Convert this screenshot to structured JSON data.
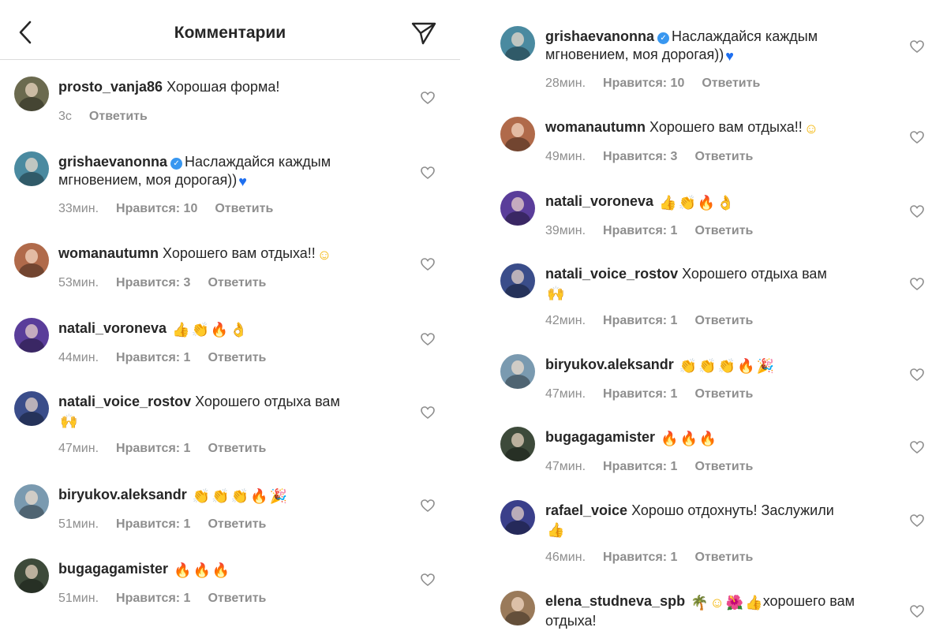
{
  "header": {
    "title": "Комментарии"
  },
  "left": [
    {
      "user": "prosto_vanja86",
      "verified": false,
      "text": "Хорошая форма!",
      "emojis": [],
      "text2": "",
      "time": "3с",
      "likes": "",
      "reply": "Ответить",
      "avatar_bg": "#6b6a4f"
    },
    {
      "user": "grishaevanonna",
      "verified": true,
      "text": "Наслаждайся каждым мгновением, моя дорогая))",
      "emojis": [
        {
          "g": "♥",
          "c": "emo-heart"
        }
      ],
      "text2": "",
      "time": "33мин.",
      "likes": "Нравится: 10",
      "reply": "Ответить",
      "avatar_bg": "#4a8aa0"
    },
    {
      "user": "womanautumn",
      "verified": false,
      "text": "Хорошего вам отдыха!!",
      "emojis": [
        {
          "g": "☺",
          "c": "emo-smile"
        }
      ],
      "text2": "",
      "time": "53мин.",
      "likes": "Нравится: 3",
      "reply": "Ответить",
      "avatar_bg": "#b06a4a"
    },
    {
      "user": "natali_voroneva",
      "verified": false,
      "text": "",
      "emojis": [
        {
          "g": "👍",
          "c": "emo-thumb"
        },
        {
          "g": "👏",
          "c": "emo-clap"
        },
        {
          "g": "🔥",
          "c": "emo-fire"
        },
        {
          "g": "👌",
          "c": "emo-ok"
        }
      ],
      "text2": "",
      "time": "44мин.",
      "likes": "Нравится: 1",
      "reply": "Ответить",
      "avatar_bg": "#5a3d9a"
    },
    {
      "user": "natali_voice_rostov",
      "verified": false,
      "text": "Хорошего отдыха вам",
      "emojis": [],
      "text2": "🙌",
      "time": "47мин.",
      "likes": "Нравится: 1",
      "reply": "Ответить",
      "avatar_bg": "#3a4d8a"
    },
    {
      "user": "biryukov.aleksandr",
      "verified": false,
      "text": "",
      "emojis": [
        {
          "g": "👏",
          "c": "emo-clap"
        },
        {
          "g": "👏",
          "c": "emo-clap"
        },
        {
          "g": "👏",
          "c": "emo-clap"
        },
        {
          "g": "🔥",
          "c": "emo-fire"
        },
        {
          "g": "🎉",
          "c": "emo-party"
        }
      ],
      "text2": "",
      "time": "51мин.",
      "likes": "Нравится: 1",
      "reply": "Ответить",
      "avatar_bg": "#7a9ab0"
    },
    {
      "user": "bugagagamister",
      "verified": false,
      "text": "",
      "emojis": [
        {
          "g": "🔥",
          "c": "emo-fire"
        },
        {
          "g": "🔥",
          "c": "emo-fire"
        },
        {
          "g": "🔥",
          "c": "emo-fire"
        }
      ],
      "text2": "",
      "time": "51мин.",
      "likes": "Нравится: 1",
      "reply": "Ответить",
      "avatar_bg": "#3d4a3a"
    }
  ],
  "right": [
    {
      "user": "grishaevanonna",
      "verified": true,
      "text": "Наслаждайся каждым мгновением, моя дорогая))",
      "emojis": [
        {
          "g": "♥",
          "c": "emo-heart"
        }
      ],
      "text2": "",
      "time": "28мин.",
      "likes": "Нравится: 10",
      "reply": "Ответить",
      "avatar_bg": "#4a8aa0"
    },
    {
      "user": "womanautumn",
      "verified": false,
      "text": "Хорошего вам отдыха!!",
      "emojis": [
        {
          "g": "☺",
          "c": "emo-smile"
        }
      ],
      "text2": "",
      "time": "49мин.",
      "likes": "Нравится: 3",
      "reply": "Ответить",
      "avatar_bg": "#b06a4a"
    },
    {
      "user": "natali_voroneva",
      "verified": false,
      "text": "",
      "emojis": [
        {
          "g": "👍",
          "c": "emo-thumb"
        },
        {
          "g": "👏",
          "c": "emo-clap"
        },
        {
          "g": "🔥",
          "c": "emo-fire"
        },
        {
          "g": "👌",
          "c": "emo-ok"
        }
      ],
      "text2": "",
      "time": "39мин.",
      "likes": "Нравится: 1",
      "reply": "Ответить",
      "avatar_bg": "#5a3d9a"
    },
    {
      "user": "natali_voice_rostov",
      "verified": false,
      "text": "Хорошего отдыха вам",
      "emojis": [],
      "text2": "🙌",
      "time": "42мин.",
      "likes": "Нравится: 1",
      "reply": "Ответить",
      "avatar_bg": "#3a4d8a"
    },
    {
      "user": "biryukov.aleksandr",
      "verified": false,
      "text": "",
      "emojis": [
        {
          "g": "👏",
          "c": "emo-clap"
        },
        {
          "g": "👏",
          "c": "emo-clap"
        },
        {
          "g": "👏",
          "c": "emo-clap"
        },
        {
          "g": "🔥",
          "c": "emo-fire"
        },
        {
          "g": "🎉",
          "c": "emo-party"
        }
      ],
      "text2": "",
      "time": "47мин.",
      "likes": "Нравится: 1",
      "reply": "Ответить",
      "avatar_bg": "#7a9ab0"
    },
    {
      "user": "bugagagamister",
      "verified": false,
      "text": "",
      "emojis": [
        {
          "g": "🔥",
          "c": "emo-fire"
        },
        {
          "g": "🔥",
          "c": "emo-fire"
        },
        {
          "g": "🔥",
          "c": "emo-fire"
        }
      ],
      "text2": "",
      "time": "47мин.",
      "likes": "Нравится: 1",
      "reply": "Ответить",
      "avatar_bg": "#3d4a3a"
    },
    {
      "user": "rafael_voice",
      "verified": false,
      "text": "Хорошо отдохнуть! Заслужили",
      "emojis": [],
      "text2": "👍",
      "time": "46мин.",
      "likes": "Нравится: 1",
      "reply": "Ответить",
      "avatar_bg": "#3a3f8a"
    },
    {
      "user": "elena_studneva_spb",
      "verified": false,
      "text": "",
      "emojis": [
        {
          "g": "🌴",
          "c": "emo-palm"
        },
        {
          "g": "☺",
          "c": "emo-smile"
        },
        {
          "g": "🌺",
          "c": "emo-flower"
        },
        {
          "g": "👍",
          "c": "emo-thumb"
        }
      ],
      "text2": "",
      "text_after": "хорошего вам отдыха!",
      "time": "",
      "likes": "",
      "reply": "",
      "avatar_bg": "#9a7a5a"
    }
  ]
}
